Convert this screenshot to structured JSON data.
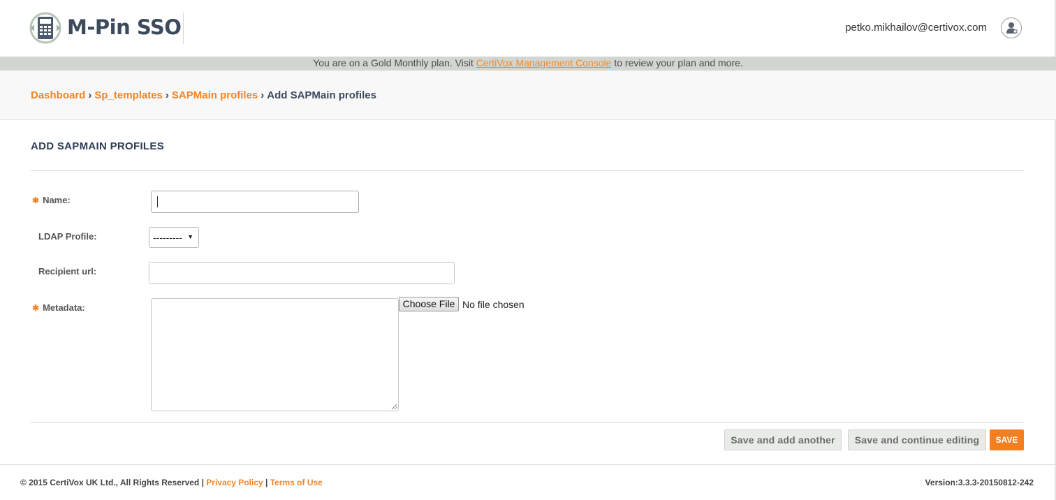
{
  "header": {
    "brand": "M-Pin SSO",
    "user_email": "petko.mikhailov@certivox.com"
  },
  "plan_banner": {
    "prefix": "You are on a Gold Monthly plan. Visit ",
    "link": "CertiVox Management Console",
    "suffix": " to review your plan and more."
  },
  "breadcrumb": {
    "items": [
      "Dashboard",
      "Sp_templates",
      "SAPMain profiles"
    ],
    "current": "Add SAPMain profiles",
    "separator": "›"
  },
  "form": {
    "title": "ADD SAPMAIN PROFILES",
    "required_marker": "✱",
    "name": {
      "label": "Name:",
      "value": ""
    },
    "ldap_profile": {
      "label": "LDAP Profile:",
      "selected": "---------"
    },
    "recipient_url": {
      "label": "Recipient url:",
      "value": ""
    },
    "metadata": {
      "label": "Metadata:",
      "choose_file": "Choose File",
      "file_status": "No file chosen"
    }
  },
  "actions": {
    "save_add_another": "Save and add another",
    "save_continue": "Save and continue editing",
    "save": "SAVE"
  },
  "footer": {
    "copyright": "© 2015 CertiVox UK Ltd., All Rights Reserved",
    "divider": " | ",
    "privacy": "Privacy Policy",
    "terms": "Terms of Use",
    "version": "Version:3.3.3-20150812-242"
  },
  "colors": {
    "accent": "#f0852a",
    "save_button": "#f47f20",
    "brand_text": "#3c4a5c",
    "plan_banner_bg": "#d2d6d2"
  },
  "icons": {
    "logo": "calculator-keypad-logo",
    "avatar": "user-avatar-icon"
  }
}
